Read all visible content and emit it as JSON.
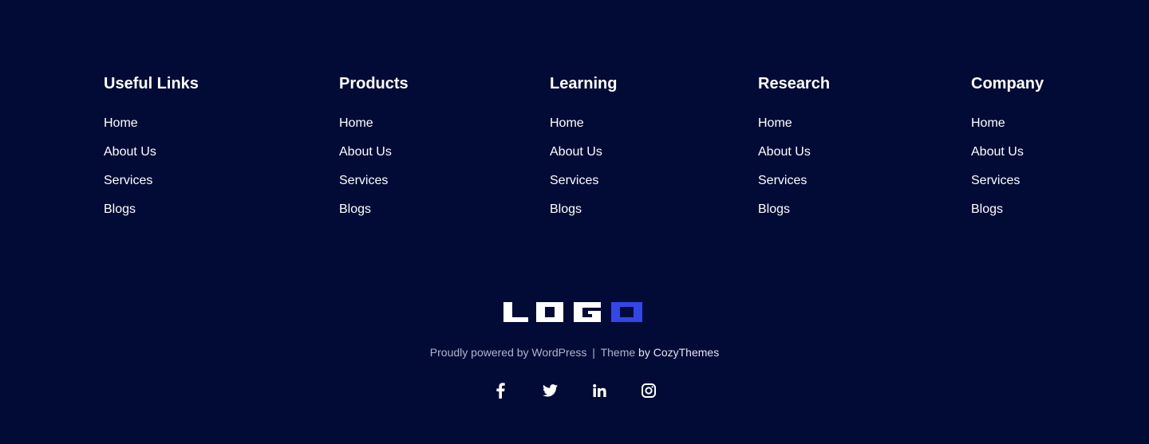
{
  "columns": [
    {
      "title": "Useful Links",
      "links": [
        "Home",
        "About Us",
        "Services",
        "Blogs"
      ]
    },
    {
      "title": "Products",
      "links": [
        "Home",
        "About Us",
        "Services",
        "Blogs"
      ]
    },
    {
      "title": "Learning",
      "links": [
        "Home",
        "About Us",
        "Services",
        "Blogs"
      ]
    },
    {
      "title": "Research",
      "links": [
        "Home",
        "About Us",
        "Services",
        "Blogs"
      ]
    },
    {
      "title": "Company",
      "links": [
        "Home",
        "About Us",
        "Services",
        "Blogs"
      ]
    }
  ],
  "logo": {
    "text": "LOGO",
    "accent_color": "#3347e6"
  },
  "credit": {
    "powered": "Proudly powered by WordPress",
    "separator": "|",
    "theme": "Theme",
    "by": "by CozyThemes"
  },
  "social": [
    {
      "icon": "facebook-icon"
    },
    {
      "icon": "twitter-icon"
    },
    {
      "icon": "linkedin-icon"
    },
    {
      "icon": "instagram-icon"
    }
  ],
  "colors": {
    "background": "#020b36",
    "text": "#ffffff"
  }
}
